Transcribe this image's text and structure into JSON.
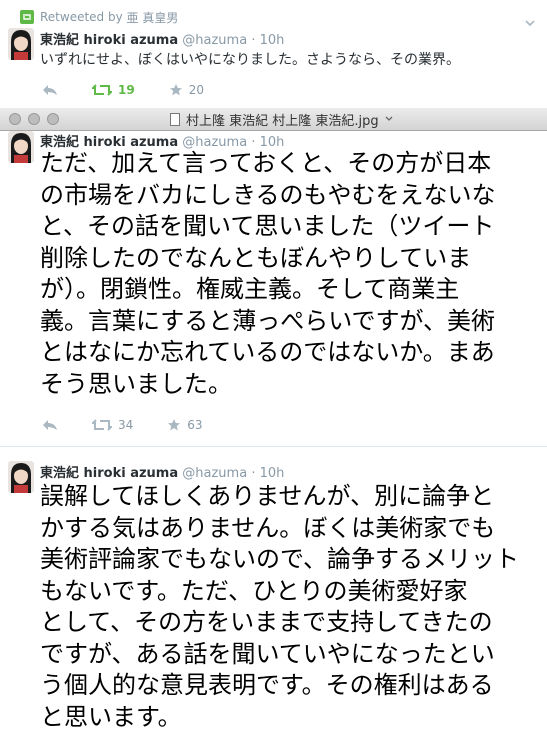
{
  "retweet_header": {
    "label": "Retweeted by",
    "user": "亜 真皇男"
  },
  "tweets": [
    {
      "name": "東浩紀 hiroki azuma",
      "handle": "@hazuma",
      "dot": "·",
      "time": "10h",
      "text": "いずれにせよ、ぼくはいやになりました。さようなら、その業界。",
      "retweets": "19",
      "favorites": "20"
    },
    {
      "name": "東浩紀 hiroki azuma",
      "handle": "@hazuma",
      "dot": "·",
      "time": "10h",
      "text_lines": [
        "ただ、加えて言っておくと、その方が日本",
        "の市場をバカにしきるのもやむをえないな",
        "と、その話を聞いて思いました（ツイート",
        "削除したのでなんともぼんやりしていま",
        "が）。閉鎖性。権威主義。そして商業主",
        "義。言葉にすると薄っぺらいですが、美術",
        "とはなにか忘れているのではないか。まあ",
        "そう思いました。"
      ],
      "retweets": "34",
      "favorites": "63"
    },
    {
      "name": "東浩紀 hiroki azuma",
      "handle": "@hazuma",
      "dot": "·",
      "time": "10h",
      "text_lines": [
        "誤解してほしくありませんが、別に論争と",
        "かする気はありません。ぼくは美術家でも",
        "美術評論家でもないので、論争するメリット",
        "もないです。ただ、ひとりの美術愛好家",
        "として、その方をいままで支持してきたの",
        "ですが、ある話を聞いていやになったとい",
        "う個人的な意見表明です。その権利はある",
        "と思います。"
      ]
    }
  ],
  "window": {
    "title": "村上隆 東浩紀 村上隆 東浩紀.jpg"
  },
  "colors": {
    "retweet_green": "#5fb946",
    "muted": "#8899a6",
    "text": "#292f33"
  }
}
